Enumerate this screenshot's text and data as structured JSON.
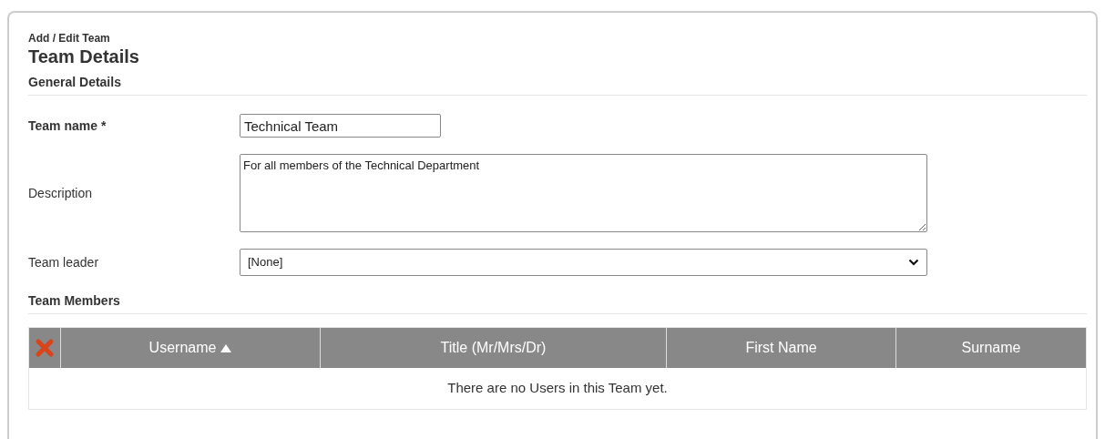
{
  "breadcrumb": "Add / Edit Team",
  "title": "Team Details",
  "sections": [
    {
      "heading": "General Details",
      "fields": [
        {
          "kind": "text",
          "label": "Team name *",
          "required": true,
          "value": "Technical Team"
        },
        {
          "kind": "textarea",
          "label": "Description",
          "required": false,
          "value": "For all members of the Technical Department"
        },
        {
          "kind": "select",
          "label": "Team leader",
          "required": false,
          "value": "[None]"
        }
      ]
    }
  ],
  "members": {
    "heading": "Team Members",
    "columns": [
      {
        "label": "Username",
        "sorted": true
      },
      {
        "label": "Title (Mr/Mrs/Dr)",
        "sorted": false
      },
      {
        "label": "First Name",
        "sorted": false
      },
      {
        "label": "Surname",
        "sorted": false
      }
    ],
    "empty_message": "There are no Users in this Team yet."
  }
}
